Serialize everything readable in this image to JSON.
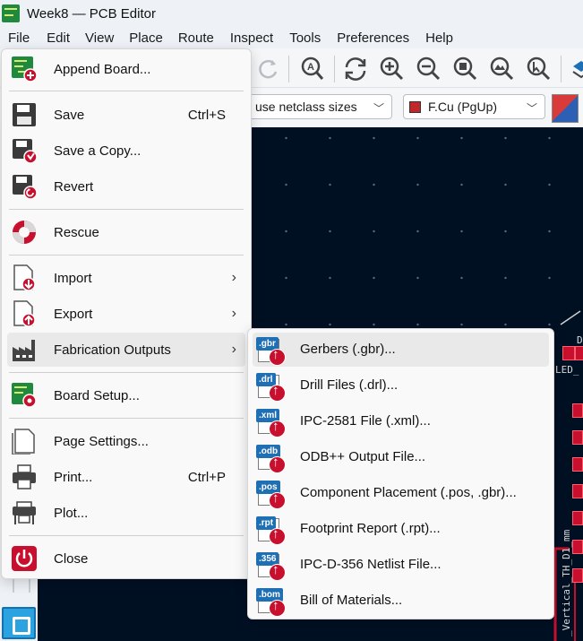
{
  "window": {
    "title": "Week8 — PCB Editor"
  },
  "menubar": [
    "File",
    "Edit",
    "View",
    "Place",
    "Route",
    "Inspect",
    "Tools",
    "Preferences",
    "Help"
  ],
  "toolbar2": {
    "track_width": "use netclass sizes",
    "layer": "F.Cu (PgUp)"
  },
  "file_menu": {
    "items": [
      {
        "label": "Append Board...",
        "icon": "append-board-icon"
      },
      {
        "label": "Save",
        "shortcut": "Ctrl+S",
        "icon": "save-icon"
      },
      {
        "label": "Save a Copy...",
        "icon": "save-copy-icon"
      },
      {
        "label": "Revert",
        "icon": "revert-icon"
      },
      {
        "label": "Rescue",
        "icon": "rescue-icon"
      },
      {
        "label": "Import",
        "icon": "import-icon",
        "submenu": true
      },
      {
        "label": "Export",
        "icon": "export-icon",
        "submenu": true
      },
      {
        "label": "Fabrication Outputs",
        "icon": "fabrication-icon",
        "submenu": true
      },
      {
        "label": "Board Setup...",
        "icon": "board-setup-icon"
      },
      {
        "label": "Page Settings...",
        "icon": "page-settings-icon"
      },
      {
        "label": "Print...",
        "shortcut": "Ctrl+P",
        "icon": "print-icon"
      },
      {
        "label": "Plot...",
        "icon": "plot-icon"
      },
      {
        "label": "Close",
        "icon": "close-icon"
      }
    ]
  },
  "fab_submenu": {
    "items": [
      {
        "label": "Gerbers (.gbr)...",
        "tag": ".gbr"
      },
      {
        "label": "Drill Files (.drl)...",
        "tag": ".drl"
      },
      {
        "label": "IPC-2581 File (.xml)...",
        "tag": ".xml"
      },
      {
        "label": "ODB++ Output File...",
        "tag": ".odb"
      },
      {
        "label": "Component Placement (.pos, .gbr)...",
        "tag": ".pos"
      },
      {
        "label": "Footprint Report (.rpt)...",
        "tag": ".rpt"
      },
      {
        "label": "IPC-D-356 Netlist File...",
        "tag": ".356"
      },
      {
        "label": "Bill of Materials...",
        "tag": ".bom"
      }
    ]
  },
  "canvas": {
    "silk_text_1": "D",
    "silk_text_2": "LED_",
    "silk_text_3": "_Vertical_TH_D1_mm"
  },
  "colors": {
    "canvas_bg": "#001023",
    "copper": "#c8102e",
    "accent": "#1f6fb5"
  }
}
